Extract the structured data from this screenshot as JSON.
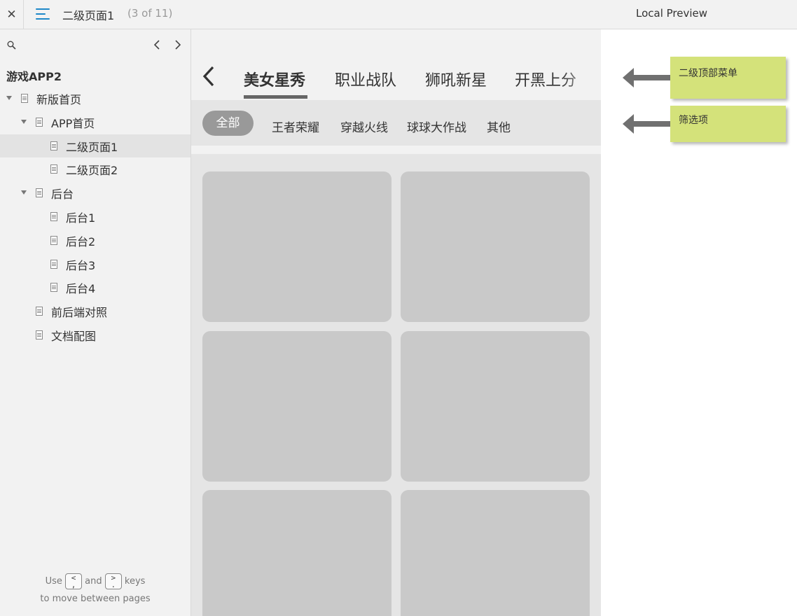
{
  "topbar": {
    "close_glyph": "✕",
    "page_title": "二级页面1",
    "page_count": "(3 of 11)",
    "preview_label": "Local Preview"
  },
  "sidebar": {
    "project_name": "游戏APP2",
    "tree": [
      {
        "label": "新版首页",
        "level": 0,
        "expanded": true,
        "selected": false
      },
      {
        "label": "APP首页",
        "level": 1,
        "expanded": true,
        "selected": false
      },
      {
        "label": "二级页面1",
        "level": 2,
        "expanded": false,
        "selected": true
      },
      {
        "label": "二级页面2",
        "level": 2,
        "expanded": false,
        "selected": false
      },
      {
        "label": "后台",
        "level": 1,
        "expanded": true,
        "selected": false
      },
      {
        "label": "后台1",
        "level": 2,
        "expanded": false,
        "selected": false
      },
      {
        "label": "后台2",
        "level": 2,
        "expanded": false,
        "selected": false
      },
      {
        "label": "后台3",
        "level": 2,
        "expanded": false,
        "selected": false
      },
      {
        "label": "后台4",
        "level": 2,
        "expanded": false,
        "selected": false
      },
      {
        "label": "前后端对照",
        "level": 1,
        "expanded": false,
        "selected": false
      },
      {
        "label": "文档配图",
        "level": 1,
        "expanded": false,
        "selected": false
      }
    ],
    "hint": {
      "use": "Use",
      "key_prev": "<",
      "key_prev_alt": ",",
      "and": "and",
      "key_next": ">",
      "key_next_alt": ".",
      "keys": "keys",
      "line2": "to move between pages"
    }
  },
  "preview": {
    "tabs": [
      "美女星秀",
      "职业战队",
      "狮吼新星",
      "开黑上分"
    ],
    "active_tab": 0,
    "filters": [
      "全部",
      "王者荣耀",
      "穿越火线",
      "球球大作战",
      "其他"
    ],
    "card_count": 6
  },
  "annotations": {
    "top_menu": "二级顶部菜单",
    "filter_items": "筛选项"
  },
  "colors": {
    "accent": "#1e88c8",
    "note_bg": "#d4e27a",
    "card_bg": "#c9c9c9",
    "pill_bg": "#999999"
  }
}
